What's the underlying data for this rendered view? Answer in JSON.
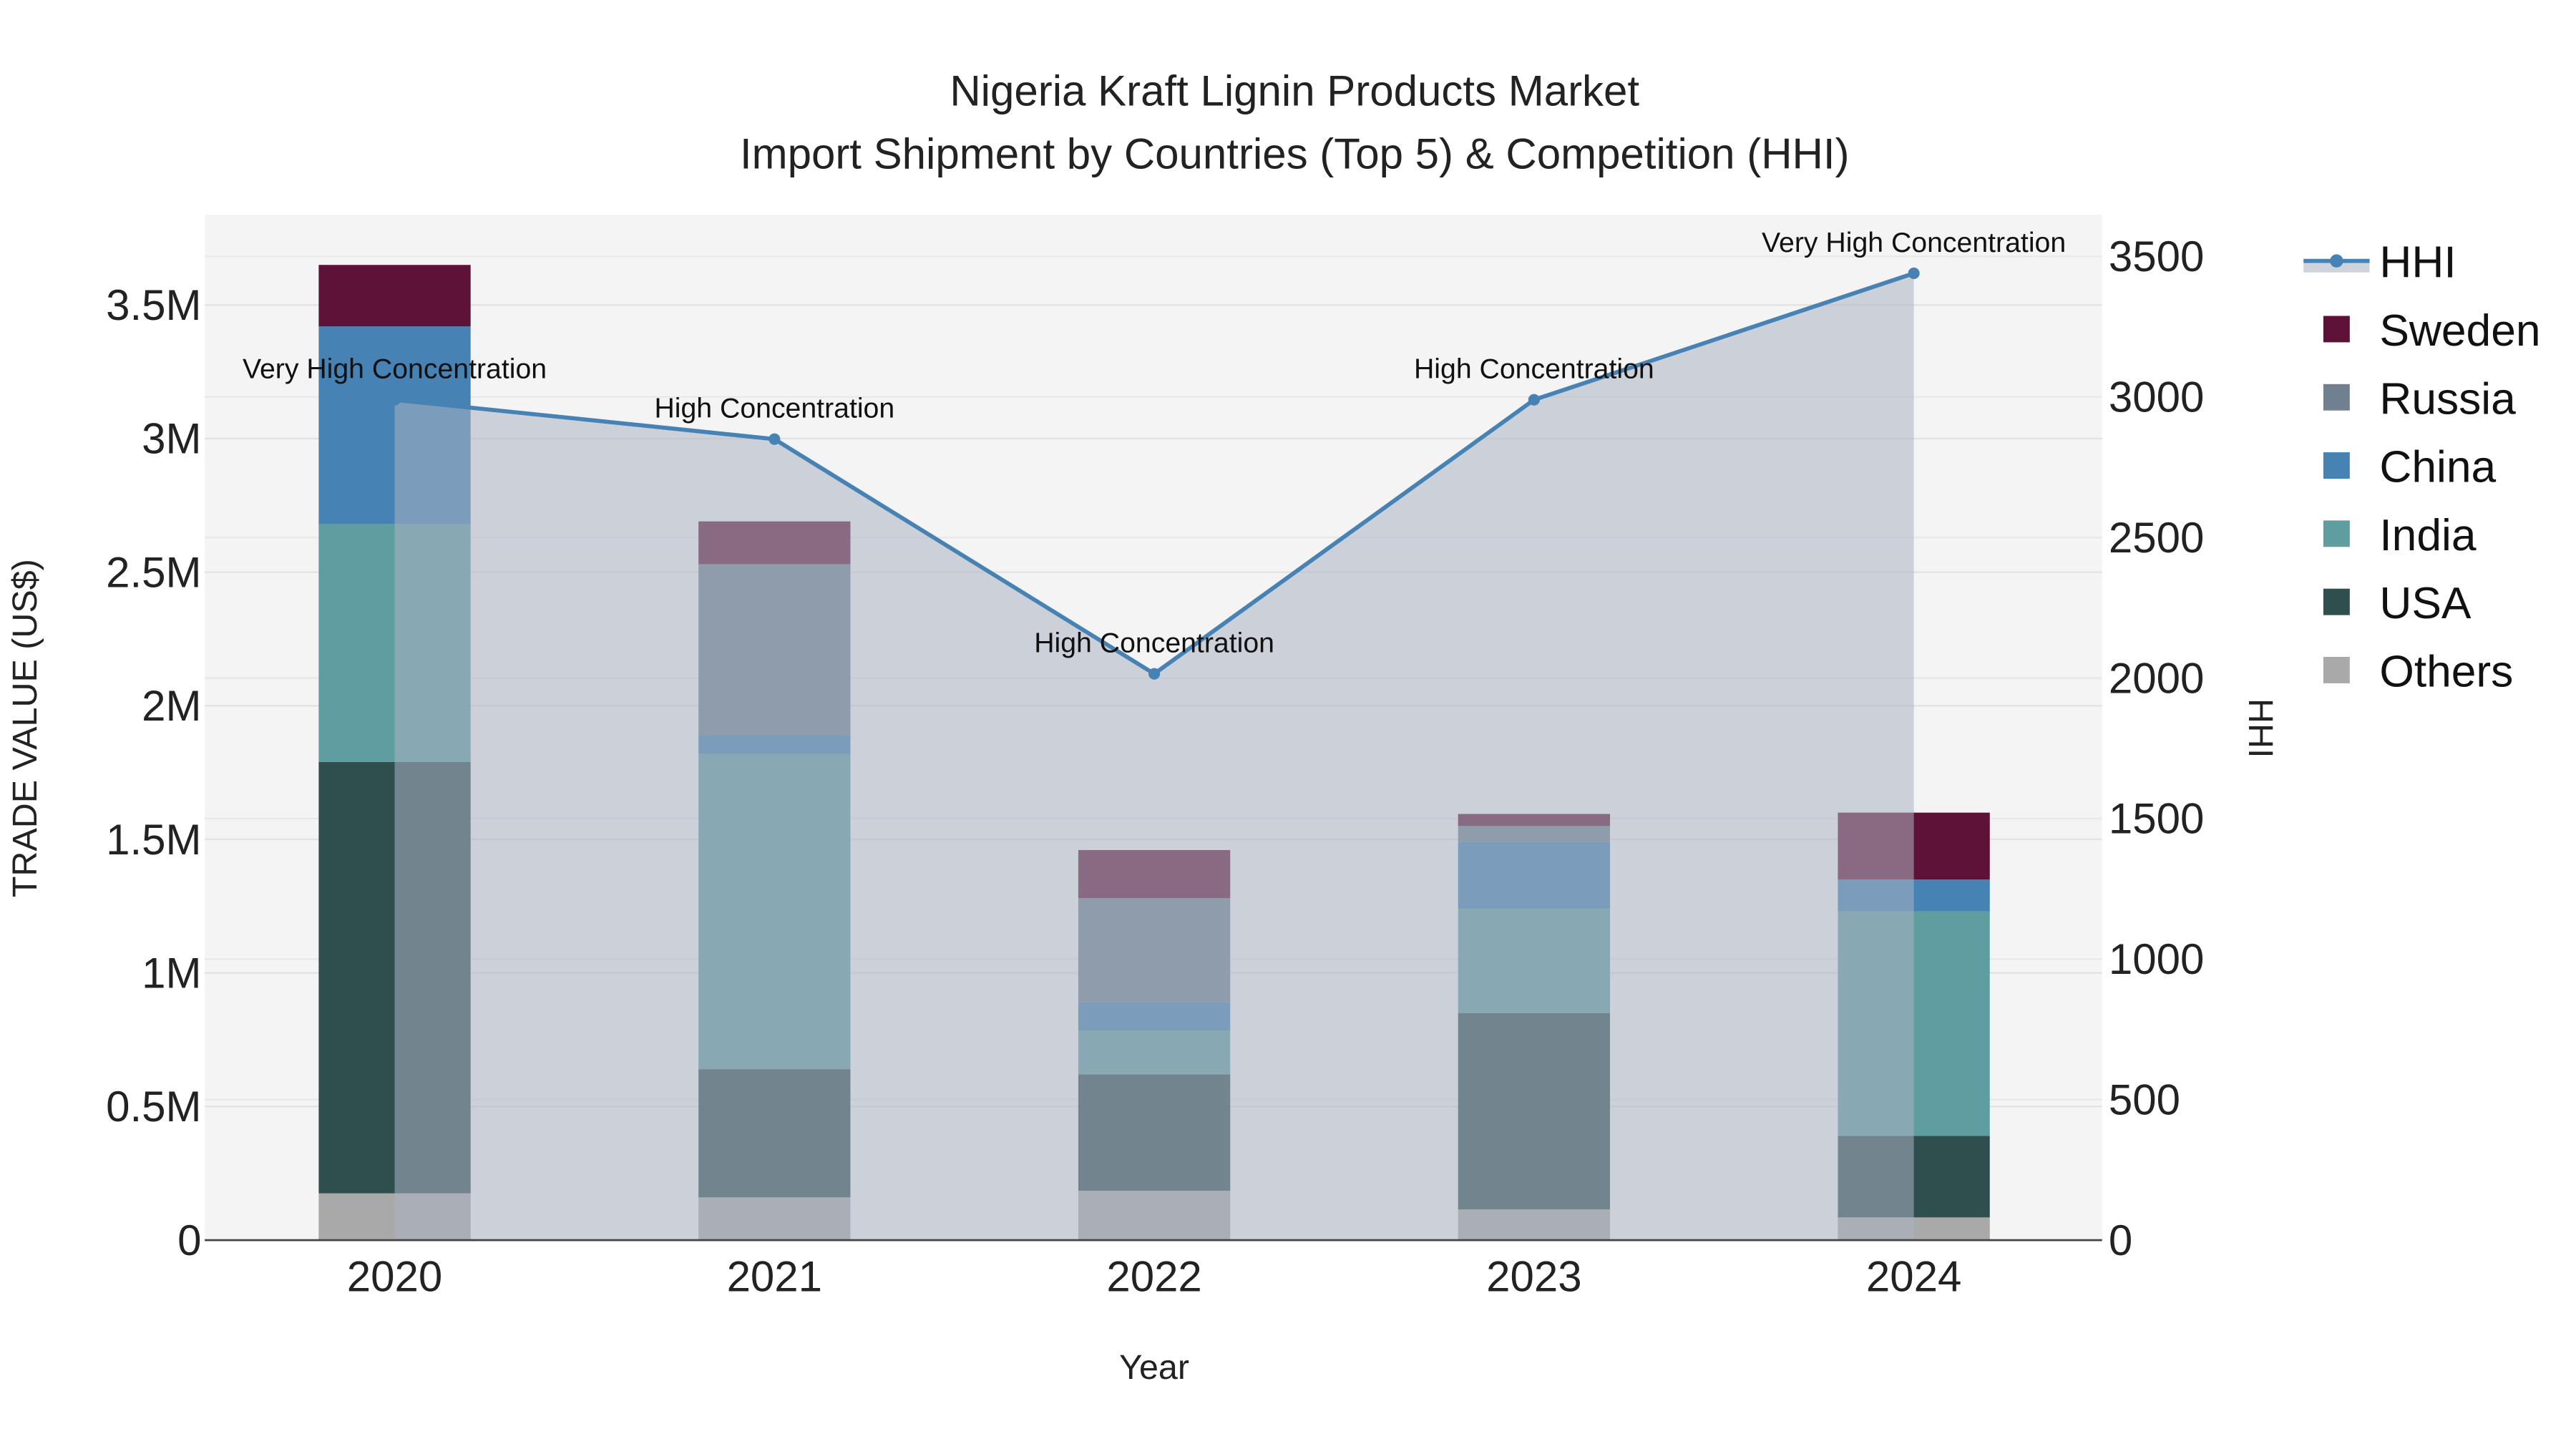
{
  "chart_data": {
    "type": "bar",
    "title": "Nigeria Kraft Lignin Products Market",
    "subtitle": "Import Shipment by Countries (Top 5) & Competition (HHI)",
    "xlabel": "Year",
    "ylabel": "TRADE VALUE (US$)",
    "y2label": "HHI",
    "categories": [
      "2020",
      "2021",
      "2022",
      "2023",
      "2024"
    ],
    "ylim": [
      0,
      3800000
    ],
    "y2lim": [
      0,
      3650
    ],
    "yticks": [
      0,
      500000,
      1000000,
      1500000,
      2000000,
      2500000,
      3000000,
      3500000
    ],
    "ytick_labels": [
      "0",
      "0.5M",
      "1M",
      "1.5M",
      "2M",
      "2.5M",
      "3M",
      "3.5M"
    ],
    "y2ticks": [
      0,
      500,
      1000,
      1500,
      2000,
      2500,
      3000,
      3500
    ],
    "y2tick_labels": [
      "0",
      "500",
      "1000",
      "1500",
      "2000",
      "2500",
      "3000",
      "3500"
    ],
    "grid": true,
    "legend_position": "right",
    "series": [
      {
        "name": "Others",
        "color": "#a9a9a9",
        "values": [
          175000,
          160000,
          185000,
          115000,
          85000
        ]
      },
      {
        "name": "USA",
        "color": "#2f4f4f",
        "values": [
          1615000,
          480000,
          435000,
          735000,
          305000
        ]
      },
      {
        "name": "India",
        "color": "#5f9ea0",
        "values": [
          890000,
          1180000,
          165000,
          390000,
          840000
        ]
      },
      {
        "name": "China",
        "color": "#4682b4",
        "values": [
          740000,
          70000,
          105000,
          250000,
          120000
        ]
      },
      {
        "name": "Russia",
        "color": "#708090",
        "values": [
          0,
          640000,
          390000,
          60000,
          0
        ]
      },
      {
        "name": "Sweden",
        "color": "#5f1237",
        "values": [
          230000,
          160000,
          180000,
          45000,
          250000
        ]
      }
    ],
    "line_series": {
      "name": "HHI",
      "color": "#4682b4",
      "values": [
        2990,
        2850,
        2015,
        2990,
        3440
      ],
      "annotations": [
        "Very High Concentration",
        "High Concentration",
        "High Concentration",
        "High Concentration",
        "Very High Concentration"
      ]
    },
    "legend_order": [
      "HHI",
      "Sweden",
      "Russia",
      "China",
      "India",
      "USA",
      "Others"
    ]
  }
}
